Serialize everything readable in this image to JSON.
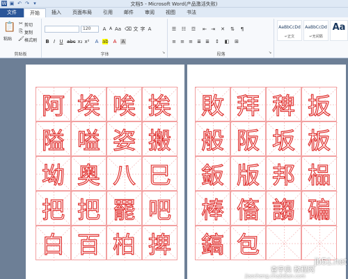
{
  "window": {
    "title": "文档5 - Microsoft Word(产品激活失败)"
  },
  "tabs": [
    "文件",
    "开始",
    "插入",
    "页面布局",
    "引用",
    "邮件",
    "审阅",
    "视图",
    "书法"
  ],
  "ribbon": {
    "clipboard": {
      "paste": "粘贴",
      "cut": "剪切",
      "copy": "复制",
      "format_painter": "格式刷",
      "label": "剪贴板"
    },
    "font": {
      "font_size": "120",
      "label": "字体"
    },
    "paragraph": {
      "label": "段落"
    },
    "styles": [
      {
        "preview": "AaBbCcDd",
        "name": "↵正文"
      },
      {
        "preview": "AaBbCcDd",
        "name": "↵无间隔"
      },
      {
        "preview": "Aa",
        "name": ""
      }
    ]
  },
  "document": {
    "page1": [
      [
        "阿",
        "埃",
        "唉",
        "挨"
      ],
      [
        "隘",
        "嗌",
        "姿",
        "搬"
      ],
      [
        "坳",
        "奥",
        "八",
        "巳"
      ],
      [
        "把",
        "把",
        "罷",
        "吧"
      ],
      [
        "白",
        "百",
        "柏",
        "捭"
      ]
    ],
    "page2": [
      [
        "敗",
        "拜",
        "稗",
        "扳"
      ],
      [
        "般",
        "阪",
        "坂",
        "板"
      ],
      [
        "鈑",
        "版",
        "邦",
        "榀"
      ],
      [
        "棒",
        "傗",
        "謅",
        "碥"
      ],
      [
        "鎬",
        "包",
        "",
        ""
      ]
    ]
  },
  "watermark": {
    "site": "jb51.net",
    "brand": "查字典 教程网",
    "url": "jiaocheng.chazidian.com"
  },
  "colors": {
    "accent": "#2a5699",
    "grid_line": "#f2a0a0",
    "glyph_stroke": "#e0302e"
  }
}
